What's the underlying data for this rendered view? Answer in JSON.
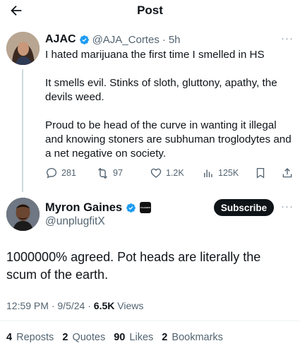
{
  "header": {
    "title": "Post"
  },
  "quoted_post": {
    "name": "AJAC",
    "handle": "@AJA_Cortes",
    "separator": "·",
    "time": "5h",
    "paragraphs": [
      "I hated marijuana the first time I smelled in HS",
      "It smells evil. Stinks of sloth, gluttony, apathy, the devils weed.",
      "Proud to be head of the curve in wanting it illegal and knowing stoners are subhuman troglodytes and a net negative on society."
    ],
    "actions": {
      "replies": "281",
      "reposts": "97",
      "likes": "1.2K",
      "views": "125K"
    }
  },
  "main_post": {
    "name": "Myron Gaines",
    "handle": "@unplugfitX",
    "affiliate_badge": "Fresh&Fit",
    "subscribe_label": "Subscribe",
    "text": "1000000% agreed. Pot heads are literally the scum of the earth.",
    "time": "12:59 PM",
    "date": "9/5/24",
    "views_count": "6.5K",
    "views_label": "Views",
    "dot": "·",
    "stats": {
      "reposts_count": "4",
      "reposts_label": "Reposts",
      "quotes_count": "2",
      "quotes_label": "Quotes",
      "likes_count": "90",
      "likes_label": "Likes",
      "bookmarks_count": "2",
      "bookmarks_label": "Bookmarks"
    }
  },
  "colors": {
    "verified": "#1d9bf0",
    "text": "#0f1419",
    "muted": "#536471",
    "button": "#0f1419"
  },
  "icons": [
    "back-arrow-icon",
    "verified-icon",
    "more-icon",
    "reply-icon",
    "repost-icon",
    "like-icon",
    "views-icon",
    "bookmark-icon",
    "share-icon"
  ]
}
